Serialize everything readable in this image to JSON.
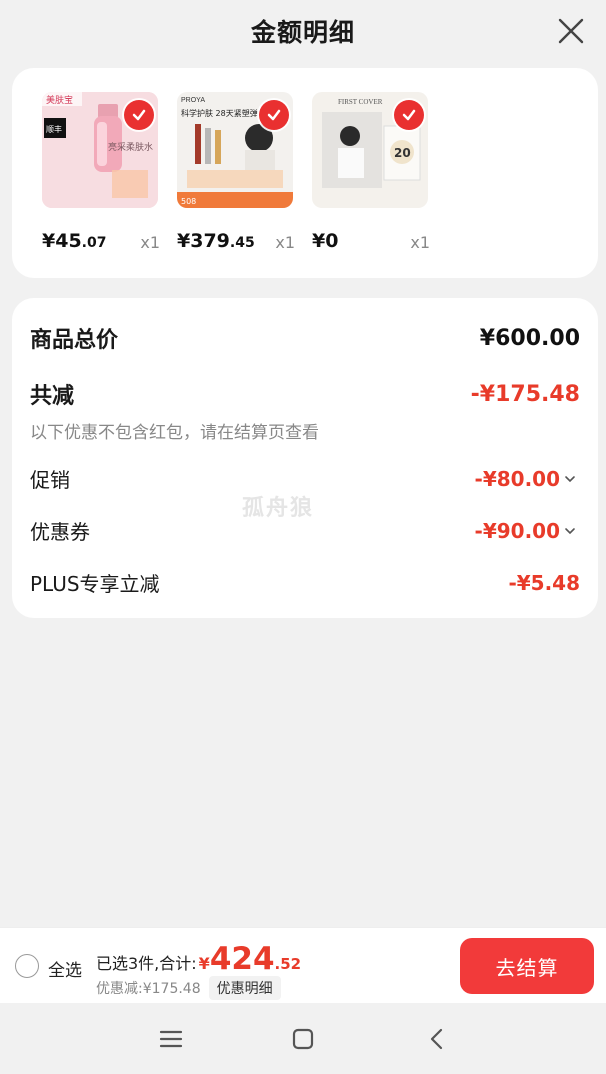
{
  "header": {
    "title": "金额明细",
    "close_icon": "close-icon"
  },
  "products": [
    {
      "price_int": "¥45",
      "price_dec": ".07",
      "qty": "x1",
      "brand_text": "美肤宝",
      "thumb_color": "#f6d8dd",
      "product_text": "亮采柔肤水"
    },
    {
      "price_int": "¥379",
      "price_dec": ".45",
      "qty": "x1",
      "brand_text": "PROYA",
      "thumb_color": "#f3f1ee",
      "product_text": "科学护肤 28天紧塑弹"
    },
    {
      "price_int": "¥0",
      "price_dec": "",
      "qty": "x1",
      "brand_text": "FIRST COVER",
      "thumb_color": "#f4f1ec",
      "product_text": "20"
    }
  ],
  "summary": {
    "total_label": "商品总价",
    "total_value": "¥600.00",
    "reduce_label": "共减",
    "reduce_value": "-¥175.48",
    "note": "以下优惠不包含红包，请在结算页查看",
    "promo_label": "促销",
    "promo_value": "-¥80.00",
    "coupon_label": "优惠券",
    "coupon_value": "-¥90.00",
    "plus_label": "PLUS专享立减",
    "plus_value": "-¥5.48",
    "watermark": "孤舟狼"
  },
  "bottom": {
    "select_all": "全选",
    "selected_text": "已选3件,合计:",
    "currency": "¥",
    "total_int": "424",
    "total_dec": ".52",
    "discount_text": "优惠减:¥175.48",
    "detail_button": "优惠明细",
    "checkout_button": "去结算"
  },
  "colors": {
    "accent": "#e83b2a",
    "button": "#f23a3a",
    "background": "#f1f1f1"
  }
}
